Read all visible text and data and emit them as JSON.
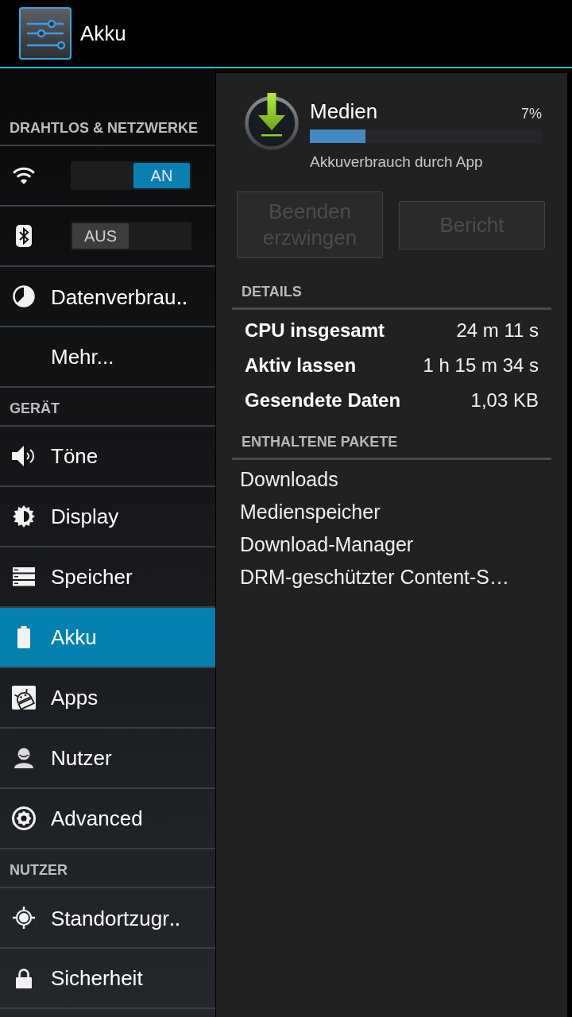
{
  "action_bar": {
    "title": "Akku"
  },
  "sidebar": {
    "sections": [
      {
        "header": "DRAHTLOS & NETZWERKE",
        "items": [
          {
            "kind": "toggle",
            "switch": {
              "label": "AN",
              "on": true
            },
            "selected": false
          },
          {
            "kind": "toggle",
            "switch": {
              "label": "AUS",
              "on": false
            },
            "selected": false
          },
          {
            "kind": "link",
            "label": "Datenverbrau‥",
            "selected": false
          },
          {
            "kind": "link",
            "label": "Mehr...",
            "selected": false
          }
        ]
      },
      {
        "header": "GERÄT",
        "items": [
          {
            "kind": "link",
            "label": "Töne",
            "selected": false
          },
          {
            "kind": "link",
            "label": "Display",
            "selected": false
          },
          {
            "kind": "link",
            "label": "Speicher",
            "selected": false
          },
          {
            "kind": "link",
            "label": "Akku",
            "selected": true
          },
          {
            "kind": "link",
            "label": "Apps",
            "selected": false
          },
          {
            "kind": "link",
            "label": "Nutzer",
            "selected": false
          },
          {
            "kind": "link",
            "label": "Advanced",
            "selected": false
          }
        ]
      },
      {
        "header": "NUTZER",
        "items": [
          {
            "kind": "link",
            "label": "Standortzugr‥",
            "selected": false
          },
          {
            "kind": "link",
            "label": "Sicherheit",
            "selected": false
          }
        ]
      }
    ]
  },
  "app": {
    "name": "Medien",
    "percent": "7%",
    "level": 0.24,
    "caption": "Akkuverbrauch durch App"
  },
  "buttons": [
    {
      "label": "Beenden erzwingen",
      "disabled": true
    },
    {
      "label": "Bericht",
      "disabled": true
    }
  ],
  "details": {
    "header": "DETAILS",
    "rows": [
      {
        "label": "CPU insgesamt",
        "value": "24 m 11 s"
      },
      {
        "label": "Aktiv lassen",
        "value": "1 h 15 m 34 s"
      },
      {
        "label": "Gesendete Daten",
        "value": "1,03 KB"
      }
    ]
  },
  "packages": {
    "header": "ENTHALTENE PAKETE",
    "items": [
      "Downloads",
      "Medienspeicher",
      "Download-Manager",
      "DRM-geschützter Content-S…"
    ]
  }
}
